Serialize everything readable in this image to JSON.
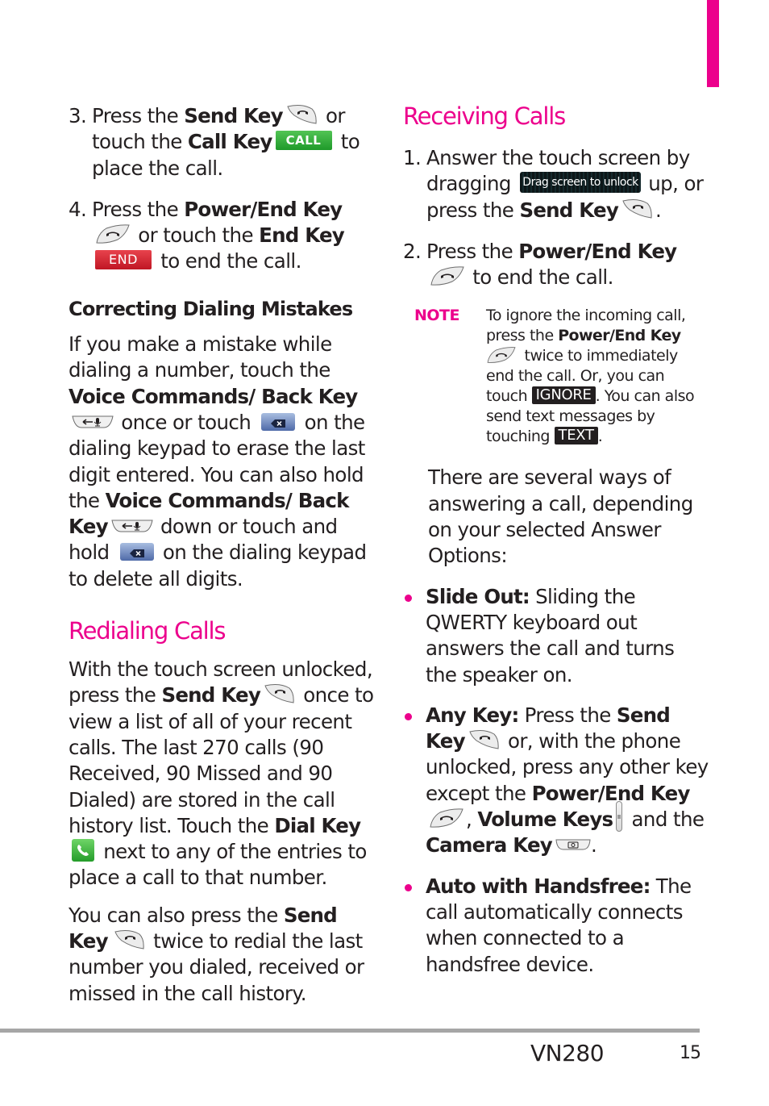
{
  "colors": {
    "accent": "#ec008c",
    "text": "#231f20",
    "call_green": "#2aa536",
    "end_red": "#d22232",
    "rule_gray": "#a6a6a6"
  },
  "left": {
    "steps": [
      {
        "num": "3.",
        "t1": "Press the ",
        "b1": "Send Key",
        "t2": " or touch the ",
        "b2": "Call Key",
        "btn": "CALL",
        "t3": " to place the call."
      },
      {
        "num": "4.",
        "t1": "Press the ",
        "b1": "Power/End Key",
        "t2": " or touch the ",
        "b2": "End Key",
        "btn": "END",
        "t3": " to end the call."
      }
    ],
    "correcting": {
      "title": "Correcting Dialing Mistakes",
      "p1": "If you make a mistake while dialing a number, touch the ",
      "b1": "Voice Commands/ Back Key",
      "p2": " once or touch ",
      "p3": " on the dialing keypad to erase the last digit entered. You can also hold the ",
      "b2": "Voice Commands/ Back Key",
      "p4": " down or touch and hold ",
      "p5": " on the dialing keypad to delete all digits."
    },
    "redialing": {
      "title": "Redialing Calls",
      "p1a": "With the touch screen unlocked, press the ",
      "p1b": "Send Key",
      "p1c": " once to view a list of all of your recent calls. The last 270 calls (90 Received, 90 Missed and 90 Dialed) are stored in the call history list. Touch the ",
      "p1d": "Dial Key",
      "p1e": " next to any of the entries to place a call to that number.",
      "p2a": "You can also press the ",
      "p2b": "Send Key",
      "p2c": " twice to redial the last number you dialed, received or missed in the call history."
    }
  },
  "right": {
    "receiving": {
      "title": "Receiving Calls",
      "steps": [
        {
          "num": "1.",
          "t1": "Answer the touch screen by dragging ",
          "btn": "Drag screen to unlock",
          "t2": " up, or press the ",
          "b1": "Send Key",
          "t3": "."
        },
        {
          "num": "2.",
          "t1": "Press the ",
          "b1": "Power/End Key",
          "t2": " to end the call."
        }
      ],
      "note": {
        "label": "NOTE",
        "t1": "To ignore the incoming call, press the ",
        "b1": "Power/End Key",
        "t2": " twice to immediately end the call. Or, you can touch ",
        "btn_ignore": "IGNORE",
        "t3": ". You can also send text messages by touching ",
        "btn_text": "TEXT",
        "t4": "."
      },
      "intro": "There are several ways of answering a call, depending on your selected Answer Options:",
      "bullets": [
        {
          "b": "Slide Out:",
          "t": " Sliding the QWERTY keyboard out answers the call and turns the speaker on."
        },
        {
          "b": "Any Key:",
          "t1": " Press the ",
          "b2": "Send Key",
          "t2": " or, with the phone unlocked, press any other key except the ",
          "b3": "Power/End Key",
          "t3": ", ",
          "b4": "Volume Keys",
          "t4": " and the ",
          "b5": "Camera Key",
          "t5": "."
        },
        {
          "b": "Auto with Handsfree:",
          "t": " The call automatically connects when connected to a handsfree device."
        }
      ]
    }
  },
  "footer": {
    "model": "VN280",
    "page": "15"
  }
}
